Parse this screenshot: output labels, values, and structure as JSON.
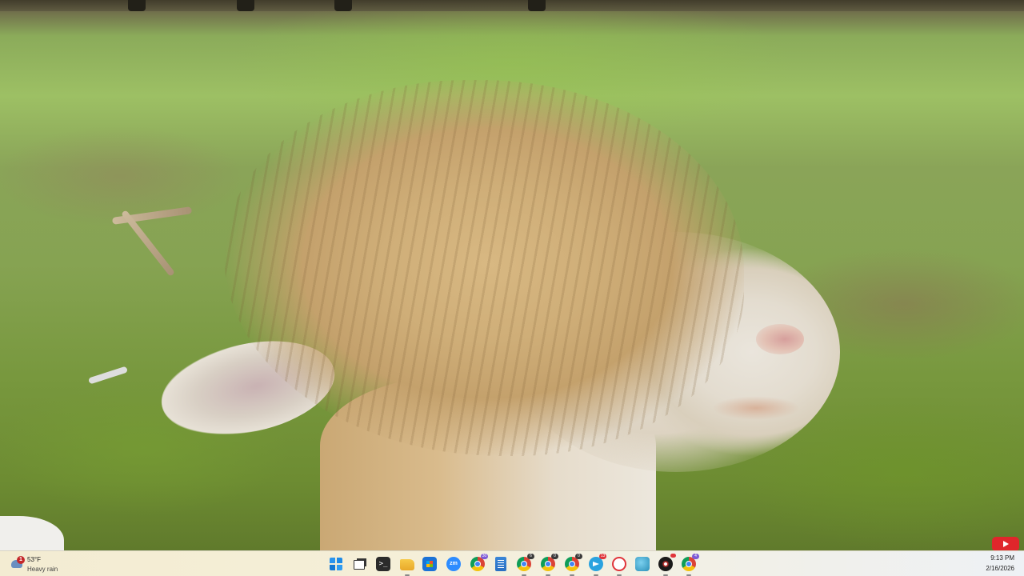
{
  "wallpaper": {
    "subject": "alpaca-photo"
  },
  "taskbar": {
    "weather": {
      "temperature": "53°F",
      "condition": "Heavy rain",
      "alert_count": "1",
      "icon": "rain-cloud-icon"
    },
    "apps": [
      {
        "name": "start",
        "icon": "windows-start-icon"
      },
      {
        "name": "task-view",
        "icon": "task-view-icon"
      },
      {
        "name": "terminal",
        "icon": "terminal-icon",
        "glyph": ">_"
      },
      {
        "name": "file-explorer",
        "icon": "folder-icon"
      },
      {
        "name": "microsoft-store",
        "icon": "store-icon"
      },
      {
        "name": "zoom",
        "icon": "zoom-icon",
        "glyph": "zm"
      },
      {
        "name": "chrome-1",
        "icon": "chrome-icon",
        "badge": "30"
      },
      {
        "name": "notepad",
        "icon": "notepad-icon"
      },
      {
        "name": "chrome-2",
        "icon": "chrome-icon",
        "badge": "6"
      },
      {
        "name": "chrome-3",
        "icon": "chrome-icon",
        "badge": "0"
      },
      {
        "name": "chrome-4",
        "icon": "chrome-icon",
        "badge": "0"
      },
      {
        "name": "telegram",
        "icon": "telegram-icon",
        "badge": "13"
      },
      {
        "name": "spinner-app",
        "icon": "spinner-icon"
      },
      {
        "name": "globe-app",
        "icon": "globe-icon"
      },
      {
        "name": "ring-app",
        "icon": "ring-icon",
        "badge": ""
      },
      {
        "name": "chrome-5",
        "icon": "chrome-icon",
        "badge": "4"
      }
    ],
    "clock": {
      "time": "9:13 PM",
      "date": "2/16/2026"
    }
  },
  "overlay": {
    "youtube_icon": "youtube-icon"
  },
  "colors": {
    "badge_dark": "#3a3a3a",
    "badge_red": "#e0343a",
    "taskbar_bg": "#f5efd8",
    "accent_blue": "#1d8ae6"
  }
}
